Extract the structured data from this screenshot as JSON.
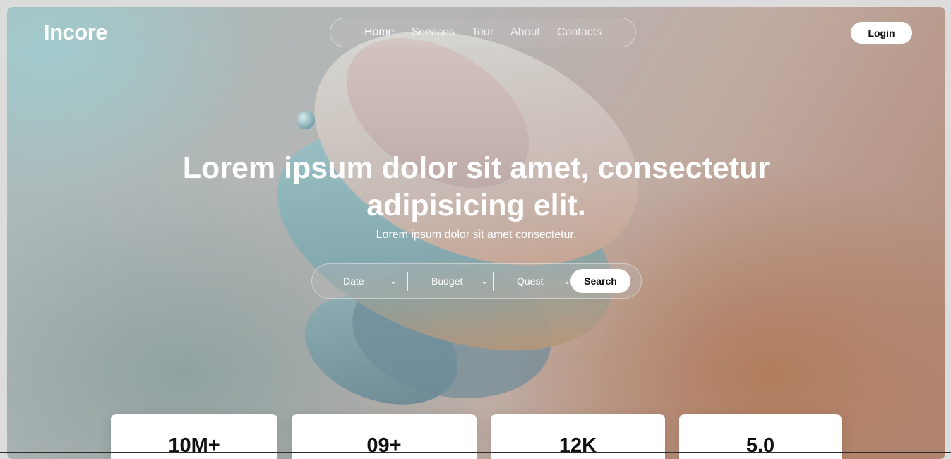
{
  "brand": {
    "logo": "Incore"
  },
  "nav": {
    "items": [
      {
        "label": "Home",
        "active": true
      },
      {
        "label": "Services",
        "active": false
      },
      {
        "label": "Tour",
        "active": false
      },
      {
        "label": "About",
        "active": false
      },
      {
        "label": "Contacts",
        "active": false
      }
    ]
  },
  "header": {
    "login_label": "Login"
  },
  "hero": {
    "title_line1": "Lorem ipsum dolor sit amet, consectetur",
    "title_line2": "adipisicing elit.",
    "subtitle": "Lorem ipsum dolor sit amet consectetur."
  },
  "search": {
    "date_label": "Date",
    "budget_label": "Budget",
    "quest_label": "Quest",
    "button_label": "Search"
  },
  "stats": [
    {
      "value": "10M+"
    },
    {
      "value": "09+"
    },
    {
      "value": "12K"
    },
    {
      "value": "5.0"
    }
  ],
  "colors": {
    "text": "#ffffff",
    "button_bg": "#ffffff",
    "button_text": "#111111",
    "accent_warm": "#b07a5a",
    "accent_cool": "#a0ccce"
  }
}
